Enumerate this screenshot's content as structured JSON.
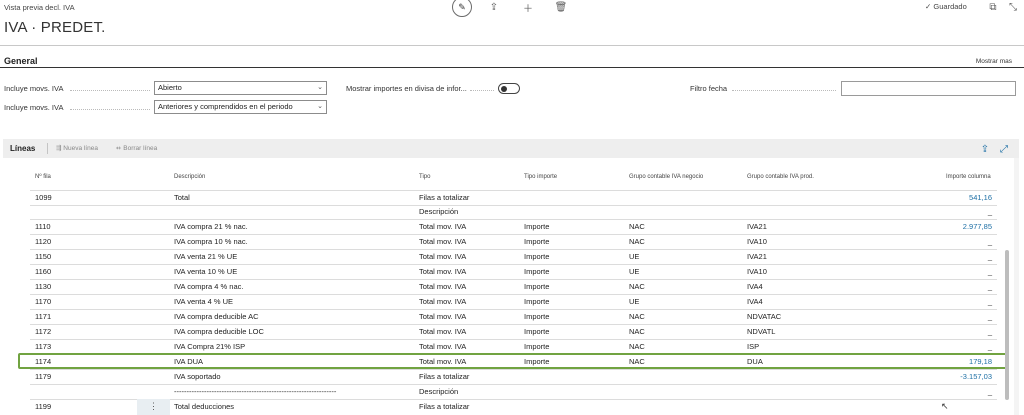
{
  "header": {
    "breadcrumb": "Vista previa decl. IVA",
    "title": "IVA · PREDET.",
    "saved_label": "Guardado"
  },
  "general": {
    "section_title": "General",
    "show_more": "Mostrar mas",
    "fields": {
      "vat_entries_1_label": "Incluye movs. IVA",
      "vat_entries_1_value": "Abierto",
      "vat_entries_2_label": "Incluye movs. IVA",
      "vat_entries_2_value": "Anteriores y comprendidos en el periodo",
      "currency_toggle_label": "Mostrar importes en divisa de infor...",
      "currency_toggle_on": false,
      "date_filter_label": "Filtro fecha",
      "date_filter_value": ""
    }
  },
  "lines": {
    "title": "Líneas",
    "new_line": "Nueva línea",
    "delete_line": "Borrar línea",
    "columns": [
      "Nº fila",
      "Descripción",
      "Tipo",
      "Tipo importe",
      "Grupo contable IVA negocio",
      "Grupo contable IVA prod.",
      "Importe columna"
    ],
    "rows": [
      {
        "n": "1099",
        "desc": "Total",
        "tipo": "Filas a totalizar",
        "timp": "",
        "neg": "",
        "prod": "",
        "imp": "541,16"
      },
      {
        "n": "",
        "desc": "",
        "tipo": "Descripción",
        "timp": "",
        "neg": "",
        "prod": "",
        "imp": "_"
      },
      {
        "n": "1110",
        "desc": "IVA compra 21 % nac.",
        "tipo": "Total mov. IVA",
        "timp": "Importe",
        "neg": "NAC",
        "prod": "IVA21",
        "imp": "2.977,85"
      },
      {
        "n": "1120",
        "desc": "IVA compra 10 % nac.",
        "tipo": "Total mov. IVA",
        "timp": "Importe",
        "neg": "NAC",
        "prod": "IVA10",
        "imp": "_"
      },
      {
        "n": "1150",
        "desc": "IVA venta 21 % UE",
        "tipo": "Total mov. IVA",
        "timp": "Importe",
        "neg": "UE",
        "prod": "IVA21",
        "imp": "_"
      },
      {
        "n": "1160",
        "desc": "IVA venta 10 % UE",
        "tipo": "Total mov. IVA",
        "timp": "Importe",
        "neg": "UE",
        "prod": "IVA10",
        "imp": "_"
      },
      {
        "n": "1130",
        "desc": "IVA compra 4 % nac.",
        "tipo": "Total mov. IVA",
        "timp": "Importe",
        "neg": "NAC",
        "prod": "IVA4",
        "imp": "_"
      },
      {
        "n": "1170",
        "desc": "IVA venta 4 % UE",
        "tipo": "Total mov. IVA",
        "timp": "Importe",
        "neg": "UE",
        "prod": "IVA4",
        "imp": "_"
      },
      {
        "n": "1171",
        "desc": "IVA compra deducible AC",
        "tipo": "Total mov. IVA",
        "timp": "Importe",
        "neg": "NAC",
        "prod": "NDVATAC",
        "imp": "_"
      },
      {
        "n": "1172",
        "desc": "IVA compra deducible LOC",
        "tipo": "Total mov. IVA",
        "timp": "Importe",
        "neg": "NAC",
        "prod": "NDVATL",
        "imp": "_"
      },
      {
        "n": "1173",
        "desc": "IVA Compra 21% ISP",
        "tipo": "Total mov. IVA",
        "timp": "Importe",
        "neg": "NAC",
        "prod": "ISP",
        "imp": "_"
      },
      {
        "n": "1174",
        "desc": "IVA DUA",
        "tipo": "Total mov. IVA",
        "timp": "Importe",
        "neg": "NAC",
        "prod": "DUA",
        "imp": "179,18"
      },
      {
        "n": "1179",
        "desc": "IVA soportado",
        "tipo": "Filas a totalizar",
        "timp": "",
        "neg": "",
        "prod": "",
        "imp": "-3.157,03"
      },
      {
        "n": "",
        "desc": "-----------------------------------------------------------------",
        "tipo": "Descripción",
        "timp": "",
        "neg": "",
        "prod": "",
        "imp": "_"
      },
      {
        "n": "1199",
        "desc": "Total deducciones",
        "tipo": "Filas a totalizar",
        "timp": "",
        "neg": "",
        "prod": "",
        "imp": ""
      }
    ]
  }
}
